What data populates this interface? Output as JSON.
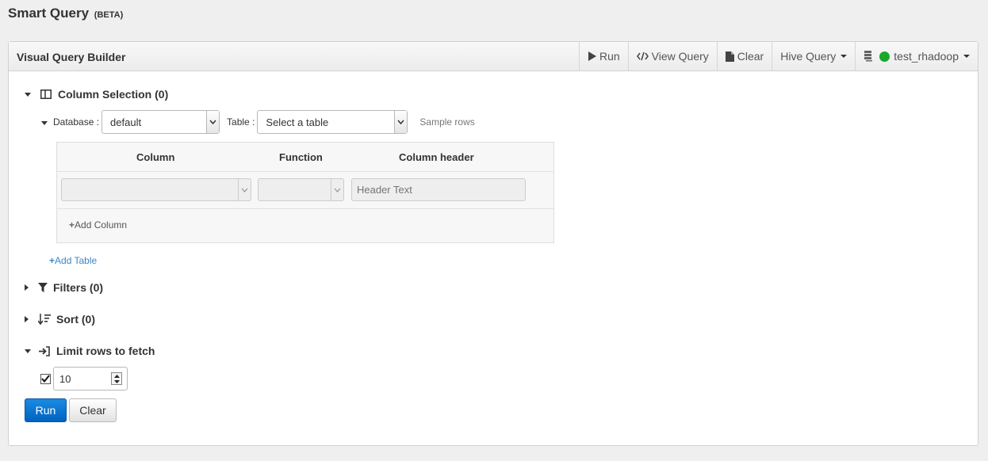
{
  "page": {
    "title": "Smart Query",
    "badge": "(BETA)"
  },
  "panel": {
    "title": "Visual Query Builder"
  },
  "toolbar": {
    "run": "Run",
    "view_query": "View Query",
    "clear": "Clear",
    "hive_query": "Hive Query",
    "connection": "test_rhadoop",
    "connection_status_color": "#18a82c"
  },
  "column_selection": {
    "title": "Column Selection (0)",
    "database_label": "Database :",
    "database_value": "default",
    "table_label": "Table :",
    "table_value": "Select a table",
    "sample_rows": "Sample rows",
    "headers": {
      "column": "Column",
      "function": "Function",
      "column_header": "Column header"
    },
    "header_placeholder": "Header Text",
    "add_column": "Add Column",
    "add_table": "Add Table"
  },
  "filters": {
    "title": "Filters (0)"
  },
  "sort": {
    "title": "Sort (0)"
  },
  "limit": {
    "title": "Limit rows to fetch",
    "checked": true,
    "value": "10"
  },
  "actions": {
    "run": "Run",
    "clear": "Clear"
  },
  "colors": {
    "primary": "#0a72d4",
    "link": "#3a86c8"
  }
}
